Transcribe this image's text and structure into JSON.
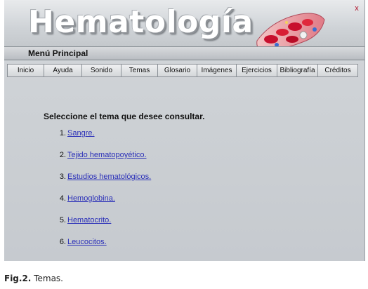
{
  "app": {
    "title": "Hematología",
    "close_label": "x",
    "menu_label": "Menú Principal"
  },
  "nav": {
    "items": [
      "Inicio",
      "Ayuda",
      "Sonido",
      "Temas",
      "Glosario",
      "Imágenes",
      "Ejercicios",
      "Bibliografía",
      "Créditos"
    ]
  },
  "content": {
    "prompt": "Seleccione el tema que desee consultar.",
    "topics": [
      {
        "number": "1.",
        "label": "Sangre."
      },
      {
        "number": "2.",
        "label": "Tejido hematopoyético."
      },
      {
        "number": "3.",
        "label": "Estudios hematológicos."
      },
      {
        "number": "4.",
        "label": "Hemoglobina."
      },
      {
        "number": "5.",
        "label": "Hematocrito."
      },
      {
        "number": "6.",
        "label": "Leucocitos."
      }
    ]
  },
  "caption": {
    "fig": "Fig.2.",
    "text": "Temas."
  }
}
